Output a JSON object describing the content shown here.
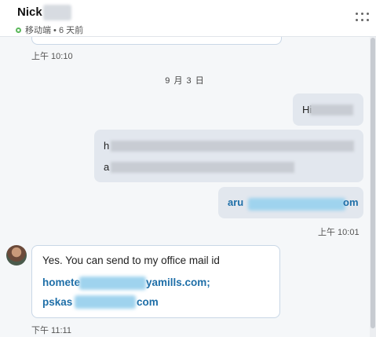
{
  "header": {
    "contact_name": "Nick",
    "status": "移动端 • 6 天前"
  },
  "messages": {
    "prev_time": "上午 10:10",
    "date_separator": "9 月 3 日",
    "out1_prefix": "Hi",
    "out2_line1_prefix": "h",
    "out2_line2_prefix": "a",
    "out3_link_prefix": "aru",
    "out3_link_suffix": "om",
    "out_time": "上午 10:01",
    "in_text": "Yes. You can send to my office mail id",
    "in_link1_prefix": "homete",
    "in_link1_suffix": "yamills.com;",
    "in_link2_prefix": "pskas",
    "in_link2_suffix": "com",
    "in_time": "下午 11:11"
  },
  "colors": {
    "link": "#1f6fa8",
    "outgoing_bubble": "#e2e7ee",
    "online": "#5bb85b"
  },
  "icons": {
    "menu": "more-vertical-dots-icon",
    "status": "online-status-icon"
  }
}
